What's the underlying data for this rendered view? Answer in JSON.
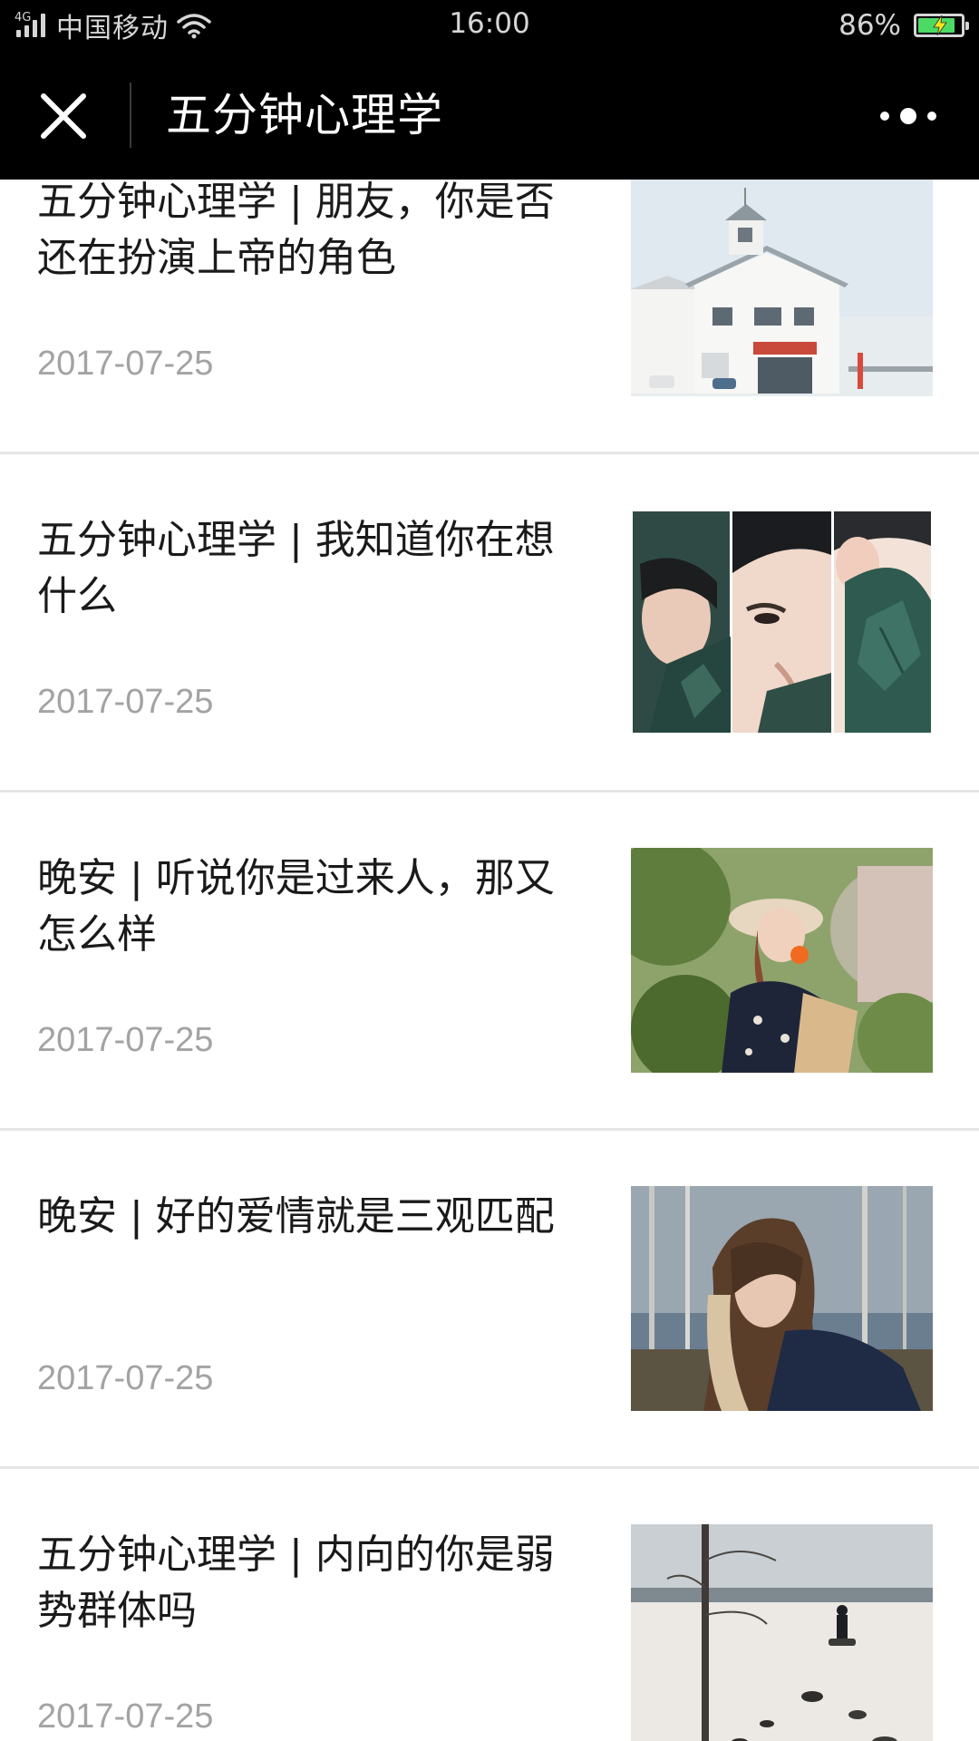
{
  "status_bar": {
    "network": "4G",
    "carrier": "中国移动",
    "time": "16:00",
    "battery_percent": "86%",
    "battery_level": 0.86,
    "charging": true
  },
  "nav": {
    "title": "五分钟心理学",
    "close_icon": "close-icon",
    "more_icon": "more-dots-icon"
  },
  "articles": [
    {
      "title": "五分钟心理学 | 朋友，你是否还在扮演上帝的角色",
      "date": "2017-07-25",
      "thumbnail": "white-harbor-building-photo"
    },
    {
      "title": "五分钟心理学 | 我知道你在想什么",
      "date": "2017-07-25",
      "thumbnail": "triptych-face-leaves-photo"
    },
    {
      "title": "晚安 | 听说你是过来人，那又怎么样",
      "date": "2017-07-25",
      "thumbnail": "woman-straw-hat-orange-photo"
    },
    {
      "title": "晚安 | 好的爱情就是三观匹配",
      "date": "2017-07-25",
      "thumbnail": "woman-forest-portrait-photo"
    },
    {
      "title": "五分钟心理学 | 内向的你是弱势群体吗",
      "date": "2017-07-25",
      "thumbnail": "person-on-snowy-lake-photo"
    }
  ]
}
